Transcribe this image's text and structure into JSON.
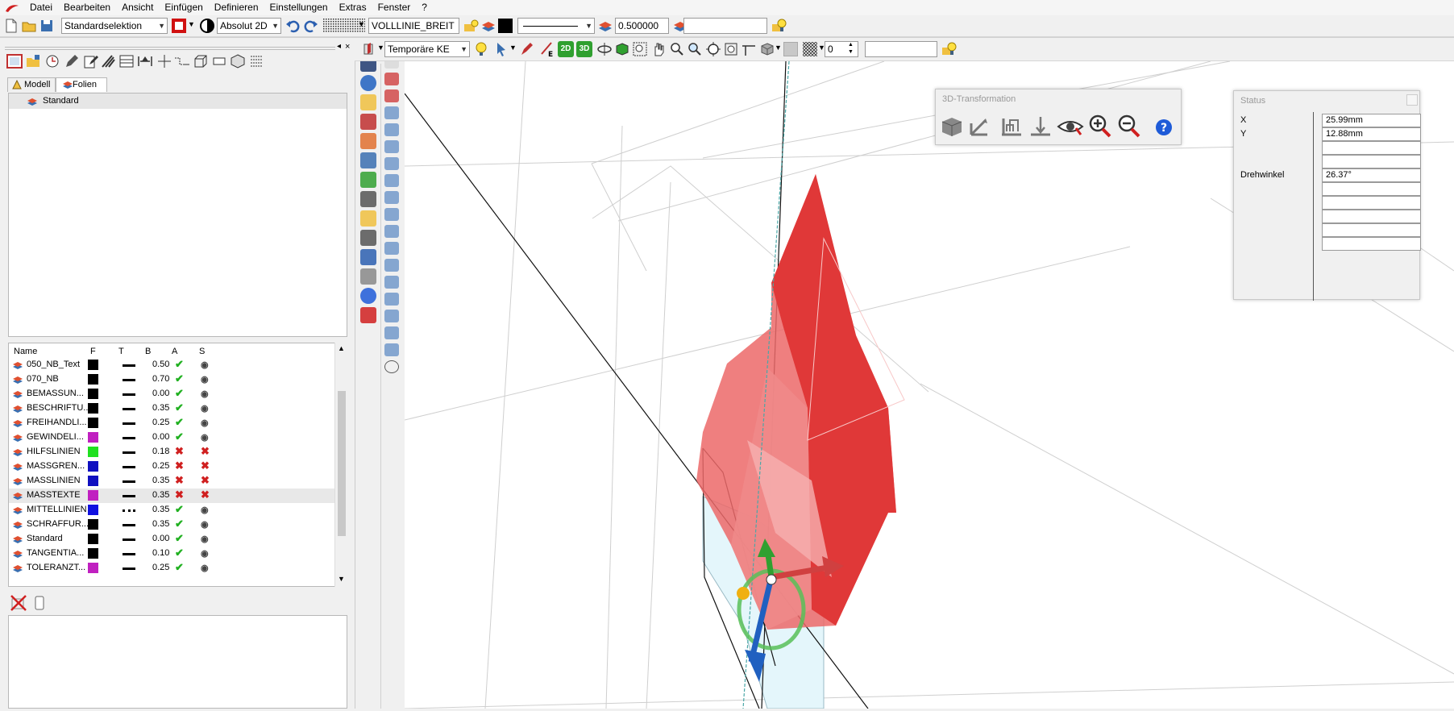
{
  "menu": [
    "Datei",
    "Bearbeiten",
    "Ansicht",
    "Einfügen",
    "Definieren",
    "Einstellungen",
    "Extras",
    "Fenster",
    "?"
  ],
  "toolbar1": {
    "selection_mode": "Standardselektion",
    "coord_mode": "Absolut 2D",
    "linestyle_name": "VOLLLINIE_BREIT",
    "pen_width": "0.500000",
    "empty_field": ""
  },
  "toolbar2": {
    "ke_mode": "Temporäre KE",
    "counter": "0",
    "empty_field": "",
    "btn_2d": "2D",
    "btn_3d": "3D"
  },
  "leftpanel": {
    "tabs": [
      "Modell",
      "Folien"
    ],
    "tree_item": "Standard",
    "columns": {
      "name": "Name",
      "f": "F",
      "t": "T",
      "b": "B",
      "a": "A",
      "s": "S"
    },
    "layers": [
      {
        "name": "050_NB_Text",
        "color": "#000000",
        "line": "solid",
        "b": "0.50",
        "a": true,
        "s": true
      },
      {
        "name": "070_NB",
        "color": "#000000",
        "line": "solid",
        "b": "0.70",
        "a": true,
        "s": true
      },
      {
        "name": "BEMASSUN...",
        "color": "#000000",
        "line": "solid",
        "b": "0.00",
        "a": true,
        "s": true
      },
      {
        "name": "BESCHRIFTU...",
        "color": "#000000",
        "line": "solid",
        "b": "0.35",
        "a": true,
        "s": true
      },
      {
        "name": "FREIHANDLI...",
        "color": "#000000",
        "line": "solid",
        "b": "0.25",
        "a": true,
        "s": true
      },
      {
        "name": "GEWINDELI...",
        "color": "#c020c0",
        "line": "solid",
        "b": "0.00",
        "a": true,
        "s": true
      },
      {
        "name": "HILFSLINIEN",
        "color": "#20e020",
        "line": "solid",
        "b": "0.18",
        "a": false,
        "s": false
      },
      {
        "name": "MASSGREN...",
        "color": "#1010c0",
        "line": "solid",
        "b": "0.25",
        "a": false,
        "s": false
      },
      {
        "name": "MASSLINIEN",
        "color": "#1010c0",
        "line": "solid",
        "b": "0.35",
        "a": false,
        "s": false
      },
      {
        "name": "MASSTEXTE",
        "color": "#c020c0",
        "line": "solid",
        "b": "0.35",
        "a": false,
        "s": false
      },
      {
        "name": "MITTELLINIEN",
        "color": "#1010e0",
        "line": "dashdot",
        "b": "0.35",
        "a": true,
        "s": true
      },
      {
        "name": "SCHRAFFUR...",
        "color": "#000000",
        "line": "solid",
        "b": "0.35",
        "a": true,
        "s": true
      },
      {
        "name": "Standard",
        "color": "#000000",
        "line": "solid",
        "b": "0.00",
        "a": true,
        "s": true
      },
      {
        "name": "TANGENTIA...",
        "color": "#000000",
        "line": "solid",
        "b": "0.10",
        "a": true,
        "s": true
      },
      {
        "name": "TOLERANZT...",
        "color": "#c020c0",
        "line": "solid",
        "b": "0.25",
        "a": true,
        "s": true
      }
    ]
  },
  "transform_window": {
    "title": "3D-Transformation"
  },
  "status_window": {
    "title": "Status",
    "rows": [
      {
        "label": "X",
        "value": "25.99mm"
      },
      {
        "label": "Y",
        "value": "12.88mm"
      },
      {
        "label": "",
        "value": ""
      },
      {
        "label": "",
        "value": ""
      },
      {
        "label": "Drehwinkel",
        "value": "26.37°"
      },
      {
        "label": "",
        "value": ""
      },
      {
        "label": "",
        "value": ""
      },
      {
        "label": "",
        "value": ""
      },
      {
        "label": "",
        "value": ""
      },
      {
        "label": "",
        "value": ""
      }
    ]
  },
  "colors": {
    "solid_red": "#e83838",
    "toolbar_bg": "#f0f0f0",
    "accent_blue": "#1e5bd8"
  }
}
